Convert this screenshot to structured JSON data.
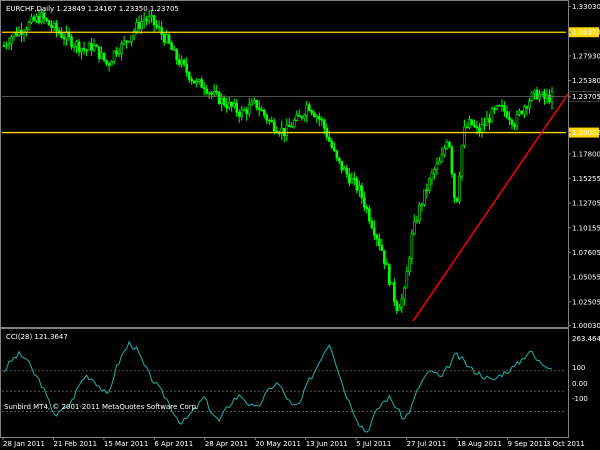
{
  "header": {
    "symbol_info": "EURCHF,Daily  1.23849 1.24167 1.23350 1.23705"
  },
  "indicator": {
    "title": "CCI(28) 121.3647",
    "levels": [
      {
        "value": "263.4644"
      },
      {
        "value": "100"
      },
      {
        "value": "0.00"
      },
      {
        "value": "-100"
      }
    ]
  },
  "watermark": "Sunbird MT4, © 2001-2011 MetaQuotes Software Corp.",
  "colors": {
    "background": "#000000",
    "candle": "#00ff00",
    "horizontal_line": "#ffd700",
    "trend_line": "#ff0000",
    "cci": "#20b2aa",
    "current_price_line": "#808080",
    "grid_text": "#ffffff"
  },
  "chart_data": {
    "type": "candlestick",
    "ylim": [
      1.0,
      1.335
    ],
    "y_ticks": [
      "1.33030",
      "1.30373",
      "1.27930",
      "1.25380",
      "1.23705",
      "1.20002",
      "1.17800",
      "1.15255",
      "1.12705",
      "1.10155",
      "1.07605",
      "1.05055",
      "1.02505",
      "1.00030"
    ],
    "x_ticks": [
      "28 Jan 2011",
      "21 Feb 2011",
      "15 Mar 2011",
      "6 Apr 2011",
      "28 Apr 2011",
      "20 May 2011",
      "13 Jun 2011",
      "5 Jul 2011",
      "27 Jul 2011",
      "18 Aug 2011",
      "9 Sep 2011",
      "3 Oct 2011"
    ],
    "horizontal_levels": [
      {
        "value": 1.30373,
        "label": "1.30373"
      },
      {
        "value": 1.20002,
        "label": "1.20002"
      }
    ],
    "current_price": {
      "value": 1.23705,
      "label": "1.23705"
    },
    "trend_line": {
      "from": 1.005,
      "to": 1.24
    },
    "price_path": [
      1.29,
      1.3,
      1.305,
      1.31,
      1.315,
      1.32,
      1.312,
      1.306,
      1.3,
      1.295,
      1.29,
      1.285,
      1.29,
      1.28,
      1.27,
      1.285,
      1.29,
      1.3,
      1.31,
      1.318,
      1.315,
      1.305,
      1.295,
      1.28,
      1.27,
      1.26,
      1.25,
      1.25,
      1.24,
      1.235,
      1.23,
      1.225,
      1.22,
      1.225,
      1.23,
      1.22,
      1.21,
      1.205,
      1.2,
      1.21,
      1.215,
      1.23,
      1.22,
      1.21,
      1.19,
      1.17,
      1.16,
      1.15,
      1.14,
      1.12,
      1.1,
      1.08,
      1.05,
      1.02,
      1.03,
      1.09,
      1.12,
      1.14,
      1.16,
      1.17,
      1.2,
      1.12,
      1.2,
      1.21,
      1.2,
      1.21,
      1.22,
      1.225,
      1.22,
      1.21,
      1.225,
      1.235,
      1.24,
      1.235,
      1.237
    ],
    "cci_range": [
      -220,
      300
    ],
    "cci_path": [
      100,
      150,
      180,
      160,
      90,
      40,
      -50,
      -120,
      -90,
      -60,
      20,
      80,
      60,
      20,
      -30,
      100,
      180,
      240,
      200,
      120,
      60,
      10,
      -40,
      -110,
      -160,
      -120,
      -80,
      -30,
      -100,
      -150,
      -90,
      -40,
      -20,
      -60,
      -90,
      -40,
      20,
      40,
      -20,
      -80,
      -60,
      40,
      100,
      180,
      240,
      120,
      0,
      -80,
      -160,
      -200,
      -120,
      -60,
      -30,
      -80,
      -140,
      -80,
      20,
      80,
      100,
      60,
      120,
      180,
      150,
      110,
      90,
      70,
      50,
      80,
      100,
      120,
      160,
      200,
      150,
      130,
      121
    ]
  }
}
